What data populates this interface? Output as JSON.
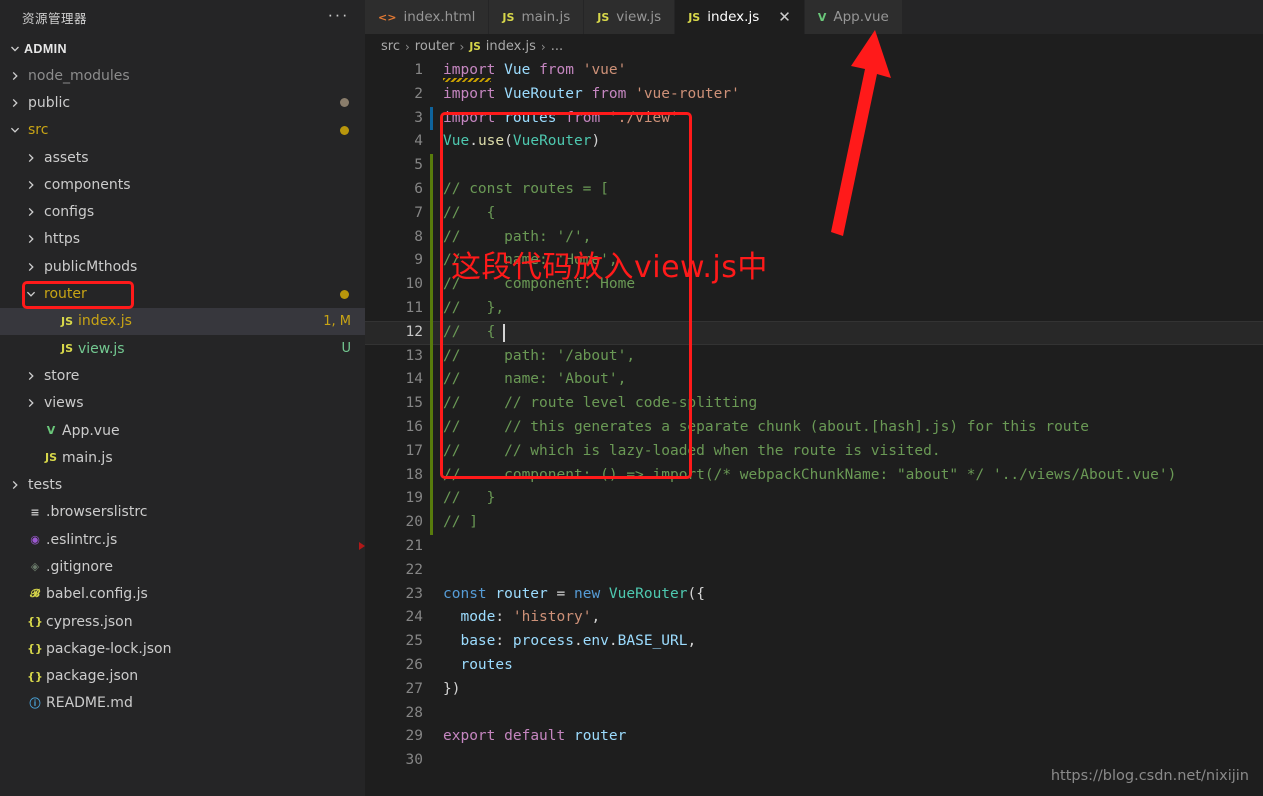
{
  "sidebar": {
    "title": "资源管理器",
    "more_label": "···",
    "root_label": "ADMIN",
    "items": [
      {
        "label": "node_modules",
        "kind": "folder",
        "expanded": false,
        "indent": 1,
        "color": "#8c8c8c",
        "icon": "chevron-right-icon",
        "badge": "",
        "dot": ""
      },
      {
        "label": "public",
        "kind": "folder",
        "expanded": false,
        "indent": 1,
        "color": "#cccccc",
        "icon": "chevron-right-icon",
        "badge": "",
        "dot": "#8a7d6b"
      },
      {
        "label": "src",
        "kind": "folder",
        "expanded": true,
        "indent": 1,
        "color": "#c8a415",
        "icon": "chevron-down-icon",
        "badge": "",
        "dot": "#b8960c"
      },
      {
        "label": "assets",
        "kind": "folder",
        "expanded": false,
        "indent": 2,
        "color": "#cccccc",
        "icon": "chevron-right-icon",
        "badge": "",
        "dot": ""
      },
      {
        "label": "components",
        "kind": "folder",
        "expanded": false,
        "indent": 2,
        "color": "#cccccc",
        "icon": "chevron-right-icon",
        "badge": "",
        "dot": ""
      },
      {
        "label": "configs",
        "kind": "folder",
        "expanded": false,
        "indent": 2,
        "color": "#cccccc",
        "icon": "chevron-right-icon",
        "badge": "",
        "dot": ""
      },
      {
        "label": "https",
        "kind": "folder",
        "expanded": false,
        "indent": 2,
        "color": "#cccccc",
        "icon": "chevron-right-icon",
        "badge": "",
        "dot": ""
      },
      {
        "label": "publicMthods",
        "kind": "folder",
        "expanded": false,
        "indent": 2,
        "color": "#cccccc",
        "icon": "chevron-right-icon",
        "badge": "",
        "dot": ""
      },
      {
        "label": "router",
        "kind": "folder",
        "expanded": true,
        "indent": 2,
        "color": "#c8a415",
        "icon": "chevron-down-icon",
        "badge": "",
        "dot": "#b8960c"
      },
      {
        "label": "index.js",
        "kind": "file",
        "file_icon": "JS",
        "file_icon_color": "#d7d74a",
        "indent": 3,
        "color": "#c8a415",
        "badge": "1, M",
        "badge_color": "#c8a415",
        "selected": true,
        "dot": ""
      },
      {
        "label": "view.js",
        "kind": "file",
        "file_icon": "JS",
        "file_icon_color": "#d7d74a",
        "indent": 3,
        "color": "#73c991",
        "badge": "U",
        "badge_color": "#73c991",
        "dot": ""
      },
      {
        "label": "store",
        "kind": "folder",
        "expanded": false,
        "indent": 2,
        "color": "#cccccc",
        "icon": "chevron-right-icon",
        "badge": "",
        "dot": ""
      },
      {
        "label": "views",
        "kind": "folder",
        "expanded": false,
        "indent": 2,
        "color": "#cccccc",
        "icon": "chevron-right-icon",
        "badge": "",
        "dot": ""
      },
      {
        "label": "App.vue",
        "kind": "file",
        "file_icon": "V",
        "file_icon_color": "#6ac77a",
        "indent": 2,
        "color": "#cccccc",
        "badge": "",
        "dot": ""
      },
      {
        "label": "main.js",
        "kind": "file",
        "file_icon": "JS",
        "file_icon_color": "#d7d74a",
        "indent": 2,
        "color": "#cccccc",
        "badge": "",
        "dot": ""
      },
      {
        "label": "tests",
        "kind": "folder",
        "expanded": false,
        "indent": 1,
        "color": "#cccccc",
        "icon": "chevron-right-icon",
        "badge": "",
        "dot": ""
      },
      {
        "label": ".browserslistrc",
        "kind": "file",
        "file_icon": "≡",
        "file_icon_color": "#cccccc",
        "indent": 1,
        "color": "#cccccc",
        "badge": "",
        "dot": ""
      },
      {
        "label": ".eslintrc.js",
        "kind": "file",
        "file_icon": "◉",
        "file_icon_color": "#9b59d0",
        "indent": 1,
        "color": "#cccccc",
        "badge": "",
        "dot": ""
      },
      {
        "label": ".gitignore",
        "kind": "file",
        "file_icon": "◈",
        "file_icon_color": "#6a7a6a",
        "indent": 1,
        "color": "#cccccc",
        "badge": "",
        "dot": ""
      },
      {
        "label": "babel.config.js",
        "kind": "file",
        "file_icon": "𝓑",
        "file_icon_color": "#d7d74a",
        "indent": 1,
        "color": "#cccccc",
        "badge": "",
        "dot": ""
      },
      {
        "label": "cypress.json",
        "kind": "file",
        "file_icon": "{}",
        "file_icon_color": "#d7d74a",
        "indent": 1,
        "color": "#cccccc",
        "badge": "",
        "dot": ""
      },
      {
        "label": "package-lock.json",
        "kind": "file",
        "file_icon": "{}",
        "file_icon_color": "#d7d74a",
        "indent": 1,
        "color": "#cccccc",
        "badge": "",
        "dot": ""
      },
      {
        "label": "package.json",
        "kind": "file",
        "file_icon": "{}",
        "file_icon_color": "#d7d74a",
        "indent": 1,
        "color": "#cccccc",
        "badge": "",
        "dot": ""
      },
      {
        "label": "README.md",
        "kind": "file",
        "file_icon": "ⓘ",
        "file_icon_color": "#4aa3d8",
        "indent": 1,
        "color": "#cccccc",
        "badge": "",
        "dot": ""
      }
    ]
  },
  "tabs": [
    {
      "label": "index.html",
      "icon": "<>",
      "icon_color": "#e37933",
      "active": false,
      "closable": false
    },
    {
      "label": "main.js",
      "icon": "JS",
      "icon_color": "#d7d74a",
      "active": false,
      "closable": false
    },
    {
      "label": "view.js",
      "icon": "JS",
      "icon_color": "#d7d74a",
      "active": false,
      "closable": false
    },
    {
      "label": "index.js",
      "icon": "JS",
      "icon_color": "#d7d74a",
      "active": true,
      "closable": true,
      "close_label": "✕"
    },
    {
      "label": "App.vue",
      "icon": "V",
      "icon_color": "#6ac77a",
      "active": false,
      "closable": false
    }
  ],
  "breadcrumb": {
    "part1": "src",
    "sep1": "›",
    "part2": "router",
    "sep2": "›",
    "js_icon": "JS",
    "part3": "index.js",
    "sep3": "›",
    "part4": "..."
  },
  "annotations": {
    "note_text": "这段代码放入view.js中",
    "accent_color": "#ff1a1a",
    "arrow_name": "red-arrow-pointing-to-active-tab",
    "box_code_name": "red-box-around-commented-routes",
    "box_router_name": "red-box-around-router-folder"
  },
  "watermark": "https://blog.csdn.net/nixijin",
  "editor": {
    "filename": "index.js",
    "cursor_line": 12,
    "total_lines": 30,
    "lines": [
      {
        "n": 1,
        "html": "<span class='k'>import</span> <span class='id'>Vue</span> <span class='k'>from</span> <span class='st'>'vue'</span>",
        "text": "import Vue from 'vue'",
        "squiggle": true
      },
      {
        "n": 2,
        "html": "<span class='k'>import</span> <span class='id'>VueRouter</span> <span class='k'>from</span> <span class='st'>'vue-router'</span>",
        "text": "import VueRouter from 'vue-router'"
      },
      {
        "n": 3,
        "html": "<span class='k'>import</span> <span class='id'>routes</span> <span class='k'>from</span> <span class='st'>'./view'</span>",
        "text": "import routes from './view'",
        "gutter": "#0e639c"
      },
      {
        "n": 4,
        "html": "<span class='cls'>Vue</span><span class='pl'>.</span><span class='fn'>use</span><span class='pl'>(</span><span class='cls'>VueRouter</span><span class='pl'>)</span>",
        "text": "Vue.use(VueRouter)"
      },
      {
        "n": 5,
        "html": "",
        "text": "",
        "gutter": "#587c0c"
      },
      {
        "n": 6,
        "html": "<span class='cm'>// const routes = [</span>",
        "text": "// const routes = [",
        "gutter": "#587c0c"
      },
      {
        "n": 7,
        "html": "<span class='cm'>//   {</span>",
        "text": "//   {",
        "gutter": "#587c0c"
      },
      {
        "n": 8,
        "html": "<span class='cm'>//     path: '/',</span>",
        "text": "//     path: '/',",
        "gutter": "#587c0c"
      },
      {
        "n": 9,
        "html": "<span class='cm'>//     name: 'Home',</span>",
        "text": "//     name: 'Home',",
        "gutter": "#587c0c"
      },
      {
        "n": 10,
        "html": "<span class='cm'>//     component: Home</span>",
        "text": "//     component: Home",
        "gutter": "#587c0c"
      },
      {
        "n": 11,
        "html": "<span class='cm'>//   },</span>",
        "text": "//   },",
        "gutter": "#587c0c"
      },
      {
        "n": 12,
        "html": "<span class='cm'>//   {</span>",
        "text": "//   {",
        "gutter": "#587c0c",
        "current": true
      },
      {
        "n": 13,
        "html": "<span class='cm'>//     path: '/about',</span>",
        "text": "//     path: '/about',",
        "gutter": "#587c0c"
      },
      {
        "n": 14,
        "html": "<span class='cm'>//     name: 'About',</span>",
        "text": "//     name: 'About',",
        "gutter": "#587c0c"
      },
      {
        "n": 15,
        "html": "<span class='cm'>//     // route level code-splitting</span>",
        "text": "//     // route level code-splitting",
        "gutter": "#587c0c"
      },
      {
        "n": 16,
        "html": "<span class='cm'>//     // this generates a separate chunk (about.[hash].js) for this route</span>",
        "text": "//     // this generates a separate chunk (about.[hash].js) for this route",
        "gutter": "#587c0c"
      },
      {
        "n": 17,
        "html": "<span class='cm'>//     // which is lazy-loaded when the route is visited.</span>",
        "text": "//     // which is lazy-loaded when the route is visited.",
        "gutter": "#587c0c"
      },
      {
        "n": 18,
        "html": "<span class='cm'>//     component: () =&gt; import(/* webpackChunkName: \"about\" */ '../views/About.vue')</span>",
        "text": "//     component: () => import(/* webpackChunkName: \"about\" */ '../views/About.vue')",
        "gutter": "#587c0c"
      },
      {
        "n": 19,
        "html": "<span class='cm'>//   }</span>",
        "text": "//   }",
        "gutter": "#587c0c"
      },
      {
        "n": 20,
        "html": "<span class='cm'>// ]</span>",
        "text": "// ]",
        "gutter": "#587c0c"
      },
      {
        "n": 21,
        "html": "",
        "text": "",
        "fold_marker": true
      },
      {
        "n": 22,
        "html": "",
        "text": ""
      },
      {
        "n": 23,
        "html": "<span class='kd'>const</span> <span class='id'>router</span> <span class='pl'>=</span> <span class='kd'>new</span> <span class='cls'>VueRouter</span><span class='pl'>({</span>",
        "text": "const router = new VueRouter({"
      },
      {
        "n": 24,
        "html": "  <span class='id'>mode</span><span class='pl'>:</span> <span class='st'>'history'</span><span class='pl'>,</span>",
        "text": "  mode: 'history',"
      },
      {
        "n": 25,
        "html": "  <span class='id'>base</span><span class='pl'>:</span> <span class='id'>process</span><span class='pl'>.</span><span class='id'>env</span><span class='pl'>.</span><span class='id'>BASE_URL</span><span class='pl'>,</span>",
        "text": "  base: process.env.BASE_URL,"
      },
      {
        "n": 26,
        "html": "  <span class='id'>routes</span>",
        "text": "  routes"
      },
      {
        "n": 27,
        "html": "<span class='pl'>})</span>",
        "text": "})"
      },
      {
        "n": 28,
        "html": "",
        "text": ""
      },
      {
        "n": 29,
        "html": "<span class='k'>export</span> <span class='k'>default</span> <span class='id'>router</span>",
        "text": "export default router"
      },
      {
        "n": 30,
        "html": "",
        "text": ""
      }
    ]
  }
}
